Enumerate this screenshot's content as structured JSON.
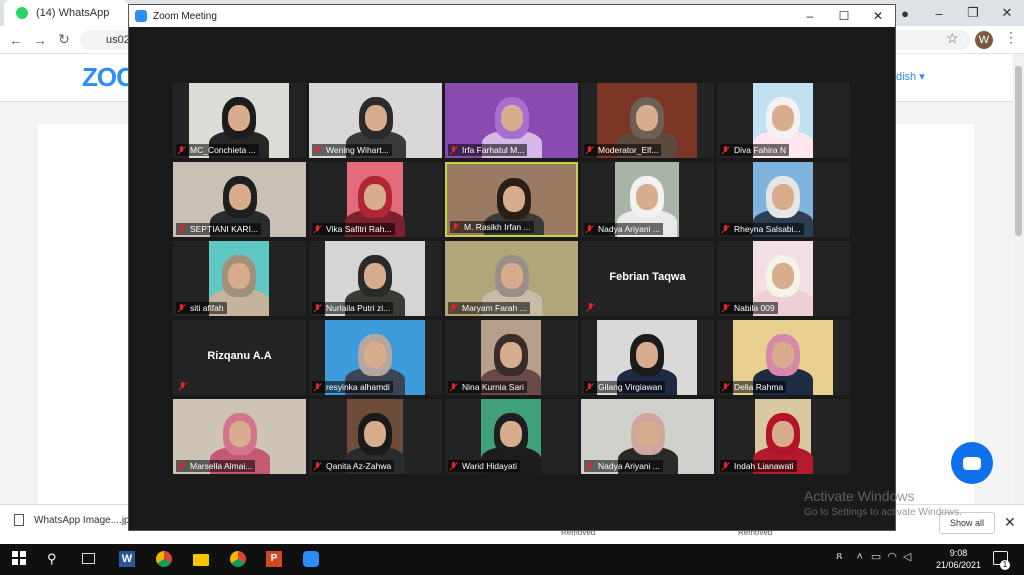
{
  "browser": {
    "tab_title": "(14) WhatsApp",
    "address": "us02",
    "profile_initial": "W",
    "colors": {
      "tabbar": "#dee1e6",
      "accent": "#2d8cff"
    }
  },
  "zoom_page": {
    "logo": "ZOO",
    "lang_link": "dish ▾",
    "chat_icon": "chat-bubble-icon"
  },
  "zoom_window": {
    "title": "Zoom Meeting",
    "controls": [
      "minimize-icon",
      "maximize-icon",
      "close-icon"
    ]
  },
  "participants": [
    {
      "label": "MC_Conchieta ..."
    },
    {
      "label": "Wening Wihart..."
    },
    {
      "label": "Irfa Farhatul M..."
    },
    {
      "label": "Moderator_Elf..."
    },
    {
      "label": "Diva Fahira N"
    },
    {
      "label": "SEPTIANI KARI..."
    },
    {
      "label": "Vika Safitri Rah..."
    },
    {
      "label": "M. Rasikh Irfan ...",
      "active_speaker": true
    },
    {
      "label": "Nadya Ariyani ..."
    },
    {
      "label": "Rheyna Salsabi..."
    },
    {
      "label": "siti afifah"
    },
    {
      "label": "Nurlaila Putri zi..."
    },
    {
      "label": "Maryam Farah ..."
    },
    {
      "label": "",
      "name_card": "Febrian Taqwa"
    },
    {
      "label": "Nabila 009"
    },
    {
      "label": "",
      "name_card": "Rizqanu A.A"
    },
    {
      "label": "resyinka alhamdi"
    },
    {
      "label": "Nina Kurnia Sari"
    },
    {
      "label": "Gilang Virgiawan"
    },
    {
      "label": "Delia Rahma"
    },
    {
      "label": "Marsella Almai..."
    },
    {
      "label": "Qanita Az-Zahwa"
    },
    {
      "label": "Warid Hidayati"
    },
    {
      "label": "Nadya Ariyani ..."
    },
    {
      "label": "Indah Lianawati"
    }
  ],
  "download_bar": {
    "file": "WhatsApp Image....jpg",
    "removed_1": "Removed",
    "removed_2": "Removed",
    "show_all": "Show all"
  },
  "watermark": {
    "title": "Activate Windows",
    "subtitle": "Go to Settings to activate Windows."
  },
  "taskbar": {
    "time": "9:08",
    "date": "21/06/2021",
    "notifications": "1"
  }
}
